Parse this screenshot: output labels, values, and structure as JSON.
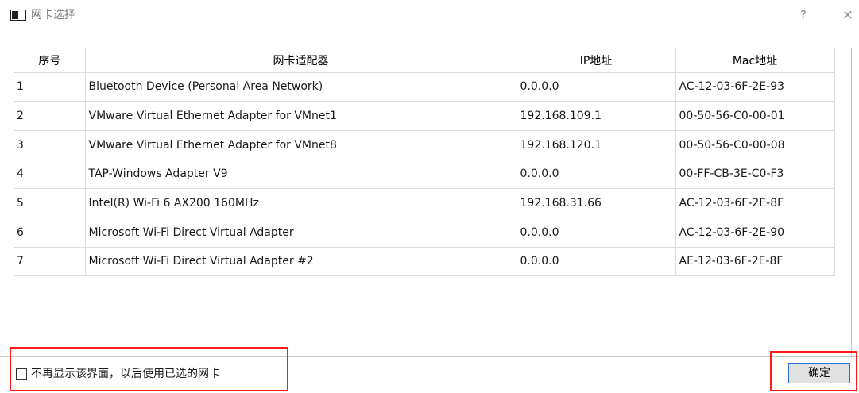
{
  "window": {
    "title": "网卡选择",
    "help_icon": "?",
    "close_icon": "×"
  },
  "table": {
    "columns": [
      "序号",
      "网卡适配器",
      "IP地址",
      "Mac地址"
    ],
    "rows": [
      {
        "index": "1",
        "adapter": "Bluetooth Device (Personal Area Network)",
        "ip": "0.0.0.0",
        "mac": "AC-12-03-6F-2E-93"
      },
      {
        "index": "2",
        "adapter": "VMware Virtual Ethernet Adapter for VMnet1",
        "ip": "192.168.109.1",
        "mac": "00-50-56-C0-00-01"
      },
      {
        "index": "3",
        "adapter": "VMware Virtual Ethernet Adapter for VMnet8",
        "ip": "192.168.120.1",
        "mac": "00-50-56-C0-00-08"
      },
      {
        "index": "4",
        "adapter": "TAP-Windows Adapter V9",
        "ip": "0.0.0.0",
        "mac": "00-FF-CB-3E-C0-F3"
      },
      {
        "index": "5",
        "adapter": "Intel(R) Wi-Fi 6 AX200 160MHz",
        "ip": "192.168.31.66",
        "mac": "AC-12-03-6F-2E-8F"
      },
      {
        "index": "6",
        "adapter": "Microsoft Wi-Fi Direct Virtual Adapter",
        "ip": "0.0.0.0",
        "mac": "AC-12-03-6F-2E-90"
      },
      {
        "index": "7",
        "adapter": "Microsoft Wi-Fi Direct Virtual Adapter #2",
        "ip": "0.0.0.0",
        "mac": "AE-12-03-6F-2E-8F"
      }
    ]
  },
  "footer": {
    "checkbox_label": "不再显示该界面，以后使用已选的网卡",
    "checkbox_checked": false,
    "ok_label": "确定"
  },
  "colors": {
    "highlight": "#ff1a1a",
    "button_focus_border": "#2a6fd6"
  }
}
